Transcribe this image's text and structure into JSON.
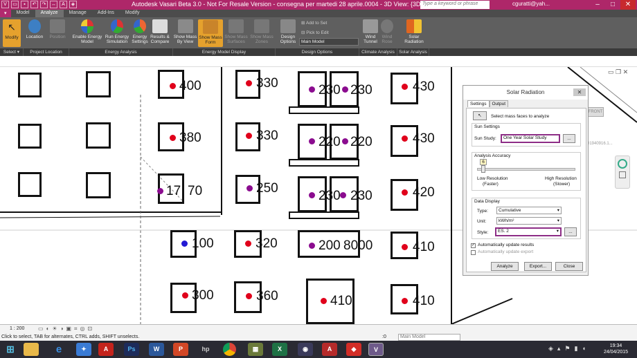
{
  "titlebar": {
    "title": "Autodesk Vasari Beta 3.0 - Not For Resale Version -      consegna per martedi 28 aprile.0004 - 3D View: {3D}",
    "search_placeholder": "Type a keyword or phrase",
    "user": "cguratti@yah...",
    "minimize": "–",
    "maximize": "□",
    "close": "✕"
  },
  "tabs": [
    "Model",
    "Analyze",
    "Manage",
    "Add-Ins",
    "Modify"
  ],
  "ribbon": {
    "modify": "Modify",
    "select": "Select ▾",
    "location": "Location",
    "position": "Position",
    "project_location": "Project Location",
    "enable_energy_model": "Enable Energy Model",
    "run_energy_simulation": "Run Energy Simulation",
    "energy_settings": "Energy Settings",
    "results_compare": "Results & Compare",
    "energy_analysis": "Energy Analysis",
    "show_mass_by_view": "Show Mass By View",
    "show_mass_form": "Show Mass Form",
    "show_mass_surfaces": "Show Mass Surfaces",
    "show_mass_zones": "Show Mass Zones",
    "energy_model_display": "Energy Model Display",
    "design_options": "Design Options",
    "add_to_set": "Add to Set",
    "pick_to_edit": "Pick to Edit",
    "main_model": "Main Model",
    "design_options_panel": "Design Options",
    "wind_tunnel": "Wind Tunnel",
    "wind_rose": "Wind Rose",
    "climate_analysis": "Climate Analysis",
    "solar_radiation": "Solar Radiation",
    "solar_analysis": "Solar Analysis"
  },
  "labels": [
    "400",
    "330",
    "230",
    "230",
    "430",
    "380",
    "330",
    "220",
    "220",
    "430",
    "17",
    "70",
    "250",
    "230",
    "230",
    "420",
    "100",
    "320",
    "200",
    "8000",
    "410",
    "300",
    "360",
    "410",
    "410"
  ],
  "dialog": {
    "title": "Solar Radiation",
    "tab_settings": "Settings",
    "tab_output": "Output",
    "select_faces": "Select mass faces to analyze",
    "sun_settings": "Sun Settings",
    "sun_study_label": "Sun Study:",
    "sun_study_value": "One Year Solar Study",
    "browse": "...",
    "analysis_accuracy": "Analysis Accuracy",
    "slider_value": "6",
    "low_res": "Low Resolution",
    "faster": "(Faster)",
    "high_res": "High Resolution",
    "slower": "(Slower)",
    "data_display": "Data Display",
    "type_label": "Type:",
    "type_value": "Cumulative",
    "unit_label": "Unit:",
    "unit_value": "kWh/m²",
    "style_label": "Style:",
    "style_value": "ES. 2",
    "auto_update_results": "Automatically update results",
    "auto_update_export": "Automatically update export",
    "analyze": "Analyze",
    "export": "Export...",
    "close": "Close"
  },
  "viewcube": {
    "front": "FRONT"
  },
  "coords_text": "01940916.1...",
  "status": {
    "scale": "1 : 200",
    "hint": "Click to select, TAB for alternates, CTRL adds, SHIFT unselects.",
    "model": "Main Model",
    "zero": ":0"
  },
  "taskbar": {
    "time": "19:34",
    "date": "24/04/2015"
  }
}
